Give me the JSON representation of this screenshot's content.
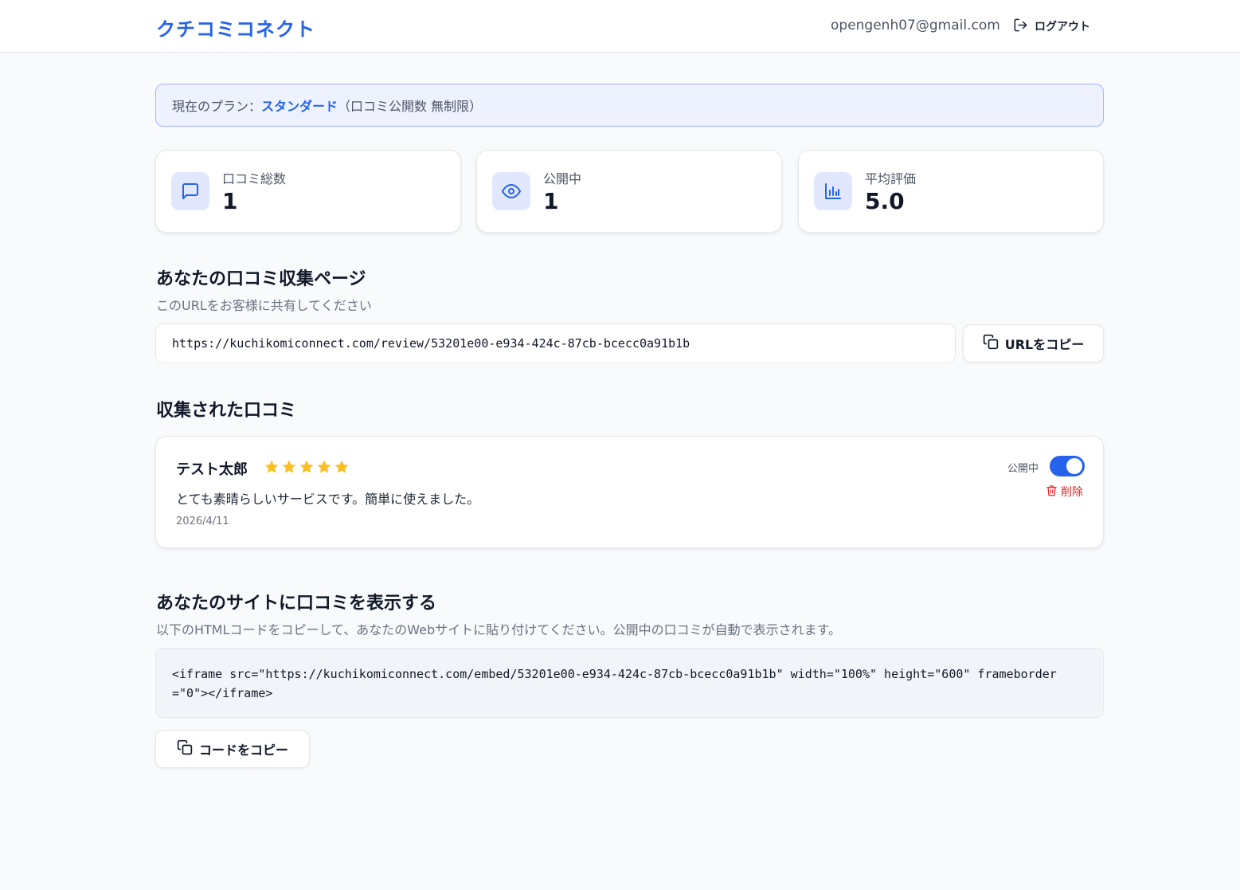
{
  "header": {
    "logo": "クチコミコネクト",
    "email": "opengenh07@gmail.com",
    "logout_label": "ログアウト"
  },
  "plan": {
    "prefix": "現在のプラン：",
    "name": "スタンダード",
    "suffix": "（口コミ公開数 無制限）"
  },
  "stats": [
    {
      "label": "口コミ総数",
      "value": "1",
      "icon": "message-square-icon"
    },
    {
      "label": "公開中",
      "value": "1",
      "icon": "eye-icon"
    },
    {
      "label": "平均評価",
      "value": "5.0",
      "icon": "bar-chart-icon"
    }
  ],
  "collect": {
    "title": "あなたの口コミ収集ページ",
    "subtitle": "このURLをお客様に共有してください",
    "url": "https://kuchikomiconnect.com/review/53201e00-e934-424c-87cb-bcecc0a91b1b",
    "copy_label": "URLをコピー"
  },
  "reviews_section": {
    "title": "収集された口コミ",
    "reviews": [
      {
        "name": "テスト太郎",
        "rating": 5,
        "text": "とても素晴らしいサービスです。簡単に使えました。",
        "date": "2026/4/11",
        "status_label": "公開中",
        "published": true,
        "delete_label": "削除"
      }
    ]
  },
  "embed": {
    "title": "あなたのサイトに口コミを表示する",
    "subtitle": "以下のHTMLコードをコピーして、あなたのWebサイトに貼り付けてください。公開中の口コミが自動で表示されます。",
    "code": "<iframe src=\"https://kuchikomiconnect.com/embed/53201e00-e934-424c-87cb-bcecc0a91b1b\" width=\"100%\" height=\"600\" frameborder=\"0\"></iframe>",
    "copy_label": "コードをコピー"
  },
  "colors": {
    "accent": "#2563eb",
    "star": "#fbbf24",
    "danger": "#dc2626"
  }
}
